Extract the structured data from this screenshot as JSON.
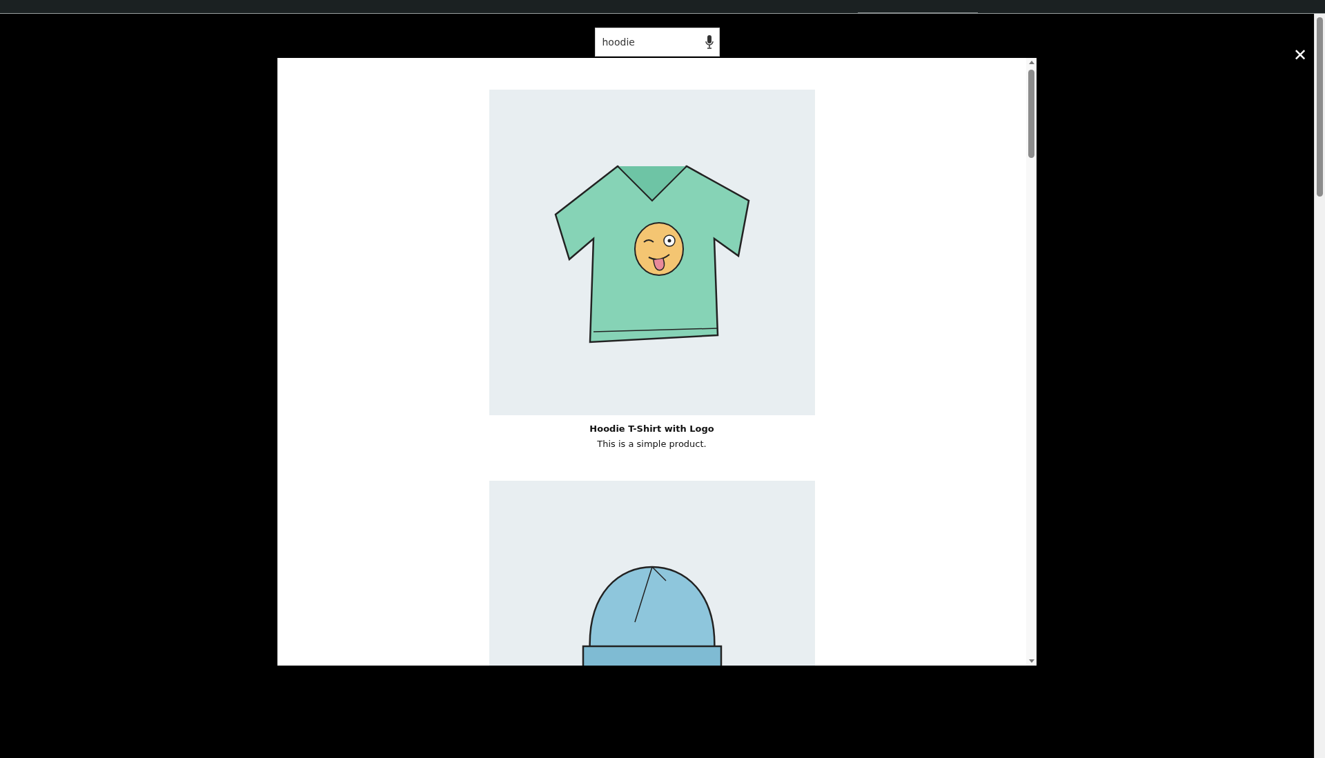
{
  "search": {
    "value": "hoodie"
  },
  "close": {
    "label": "✕"
  },
  "products": [
    {
      "kind": "tshirt",
      "title": "Hoodie T-Shirt with Logo",
      "description": "This is a simple product."
    },
    {
      "kind": "beanie"
    }
  ]
}
